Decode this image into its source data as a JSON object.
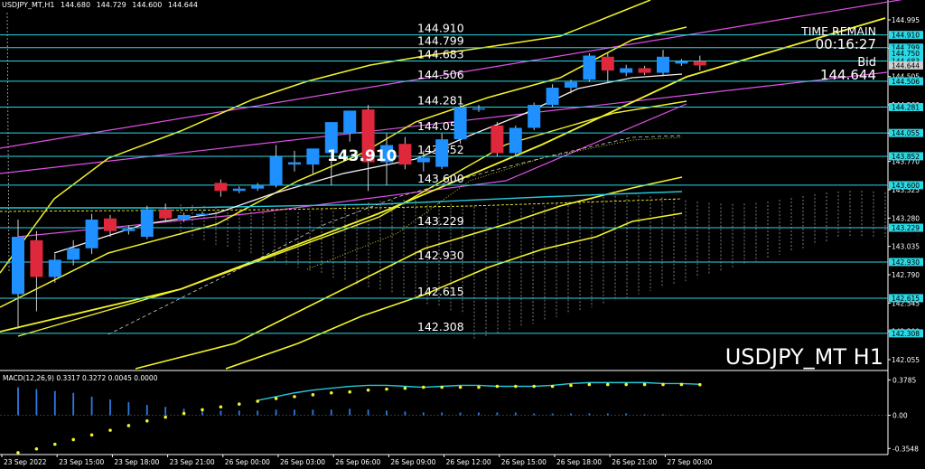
{
  "colors": {
    "background": "#000000",
    "bull_candle": "#1e90ff",
    "bear_candle": "#e0283c",
    "level_line": "#2bd8e4",
    "magenta_channel": "#e050e8",
    "yellow_band": "#f2f22a",
    "cyan_ma": "#22c8d8",
    "white_ma": "#f4f0f0",
    "cloud_dash": "#cfcfcf",
    "macd_signal": "#f2f22a",
    "macd_line": "#22c8d8",
    "macd_hist": "#2e7be0",
    "label_box": "#2bd8e4"
  },
  "header": {
    "symbol": "USDJPY_MT,H1",
    "open": "144.680",
    "high": "144.729",
    "low": "144.600",
    "close": "144.644"
  },
  "overlay": {
    "time_remain_label": "TIME REMAIN",
    "time_remain_value": "00:16:27",
    "bid_label": "Bid",
    "bid_value": "144.644",
    "big_symbol": "USDJPY_MT H1",
    "highlight_price": "143.910"
  },
  "chart_data": [
    {
      "type": "candlestick",
      "title": "USDJPY_MT H1",
      "ylim": [
        142.0,
        145.12
      ],
      "x_tick_labels": [
        "23 Sep 2022",
        "23 Sep 15:00",
        "23 Sep 18:00",
        "23 Sep 21:00",
        "26 Sep 00:00",
        "26 Sep 03:00",
        "26 Sep 06:00",
        "26 Sep 09:00",
        "26 Sep 12:00",
        "26 Sep 15:00",
        "26 Sep 18:00",
        "26 Sep 21:00",
        "27 Sep 00:00"
      ],
      "y_tick_labels": [
        "144.995",
        "144.750",
        "144.505",
        "144.260",
        "144.015",
        "143.770",
        "143.525",
        "143.280",
        "143.035",
        "142.790",
        "142.545",
        "142.300",
        "142.055"
      ],
      "candles": [
        {
          "o": 142.65,
          "h": 143.3,
          "l": 142.35,
          "c": 143.15
        },
        {
          "o": 143.12,
          "h": 143.2,
          "l": 142.5,
          "c": 142.8
        },
        {
          "o": 142.8,
          "h": 143.0,
          "l": 142.75,
          "c": 142.95
        },
        {
          "o": 142.95,
          "h": 143.12,
          "l": 142.9,
          "c": 143.05
        },
        {
          "o": 143.05,
          "h": 143.35,
          "l": 143.0,
          "c": 143.3
        },
        {
          "o": 143.31,
          "h": 143.34,
          "l": 143.15,
          "c": 143.2
        },
        {
          "o": 143.2,
          "h": 143.25,
          "l": 143.17,
          "c": 143.22
        },
        {
          "o": 143.15,
          "h": 143.42,
          "l": 143.13,
          "c": 143.39
        },
        {
          "o": 143.39,
          "h": 143.44,
          "l": 143.28,
          "c": 143.31
        },
        {
          "o": 143.3,
          "h": 143.36,
          "l": 143.28,
          "c": 143.34
        },
        {
          "o": 143.34,
          "h": 143.37,
          "l": 143.33,
          "c": 143.35
        },
        {
          "o": 143.62,
          "h": 143.65,
          "l": 143.5,
          "c": 143.55
        },
        {
          "o": 143.55,
          "h": 143.59,
          "l": 143.53,
          "c": 143.57
        },
        {
          "o": 143.57,
          "h": 143.62,
          "l": 143.55,
          "c": 143.6
        },
        {
          "o": 143.6,
          "h": 143.95,
          "l": 143.58,
          "c": 143.85
        },
        {
          "o": 143.78,
          "h": 143.9,
          "l": 143.72,
          "c": 143.8
        },
        {
          "o": 143.78,
          "h": 143.9,
          "l": 143.7,
          "c": 143.92
        },
        {
          "o": 143.88,
          "h": 144.1,
          "l": 143.6,
          "c": 144.15
        },
        {
          "o": 144.05,
          "h": 144.25,
          "l": 143.98,
          "c": 144.25
        },
        {
          "o": 144.26,
          "h": 144.3,
          "l": 143.55,
          "c": 143.8
        },
        {
          "o": 143.8,
          "h": 144.05,
          "l": 143.6,
          "c": 143.95
        },
        {
          "o": 143.96,
          "h": 144.02,
          "l": 143.74,
          "c": 143.78
        },
        {
          "o": 143.8,
          "h": 143.9,
          "l": 143.72,
          "c": 143.84
        },
        {
          "o": 143.76,
          "h": 144.05,
          "l": 143.74,
          "c": 144.0
        },
        {
          "o": 144.0,
          "h": 144.3,
          "l": 143.96,
          "c": 144.28
        },
        {
          "o": 144.26,
          "h": 144.3,
          "l": 144.24,
          "c": 144.27
        },
        {
          "o": 144.12,
          "h": 144.15,
          "l": 143.85,
          "c": 143.88
        },
        {
          "o": 143.88,
          "h": 144.12,
          "l": 143.85,
          "c": 144.1
        },
        {
          "o": 144.1,
          "h": 144.32,
          "l": 144.08,
          "c": 144.3
        },
        {
          "o": 144.3,
          "h": 144.48,
          "l": 144.28,
          "c": 144.45
        },
        {
          "o": 144.45,
          "h": 144.52,
          "l": 144.4,
          "c": 144.5
        },
        {
          "o": 144.52,
          "h": 144.75,
          "l": 144.5,
          "c": 144.73
        },
        {
          "o": 144.72,
          "h": 144.76,
          "l": 144.5,
          "c": 144.6
        },
        {
          "o": 144.58,
          "h": 144.65,
          "l": 144.55,
          "c": 144.62
        },
        {
          "o": 144.62,
          "h": 144.64,
          "l": 144.56,
          "c": 144.58
        },
        {
          "o": 144.58,
          "h": 144.78,
          "l": 144.55,
          "c": 144.72
        },
        {
          "o": 144.66,
          "h": 144.7,
          "l": 144.64,
          "c": 144.68
        },
        {
          "o": 144.68,
          "h": 144.729,
          "l": 144.6,
          "c": 144.644
        }
      ],
      "levels": [
        {
          "label": "144.910",
          "price": 144.91
        },
        {
          "label": "144.799",
          "price": 144.799
        },
        {
          "label": "144.683",
          "price": 144.683
        },
        {
          "label": "144.506",
          "price": 144.506
        },
        {
          "label": "144.281",
          "price": 144.281
        },
        {
          "label": "144.055",
          "price": 144.055
        },
        {
          "label": "143.852",
          "price": 143.852
        },
        {
          "label": "143.600",
          "price": 143.6
        },
        {
          "label": "143.229",
          "price": 143.229
        },
        {
          "label": "142.930",
          "price": 142.93
        },
        {
          "label": "142.615",
          "price": 142.615
        },
        {
          "label": "142.308",
          "price": 142.308
        }
      ],
      "right_label_boxes": [
        "144.910",
        "144.799",
        "144.750",
        "144.683",
        "144.644",
        "144.506",
        "144.281",
        "144.055",
        "143.852",
        "143.600",
        "143.229",
        "142.930",
        "142.615",
        "142.308"
      ]
    },
    {
      "type": "bar",
      "title": "MACD(12,26,9) 0.3317 0.3272 0.0045 0.0000",
      "ylim": [
        -0.42,
        0.46
      ],
      "y_tick_labels": [
        "0.3785",
        "0.00",
        "-0.3548"
      ],
      "histogram": [
        0.3,
        0.28,
        0.26,
        0.24,
        0.2,
        0.17,
        0.14,
        0.11,
        0.09,
        0.07,
        0.06,
        0.05,
        0.05,
        0.05,
        0.06,
        0.06,
        0.06,
        0.06,
        0.07,
        0.06,
        0.05,
        0.04,
        0.03,
        0.03,
        0.03,
        0.03,
        0.03,
        0.03,
        0.02,
        0.02,
        0.02,
        0.02,
        0.02,
        0.02,
        0.01,
        0.01,
        0.005,
        0.0045
      ],
      "signal": [
        -0.4,
        -0.36,
        -0.31,
        -0.26,
        -0.21,
        -0.16,
        -0.11,
        -0.06,
        -0.02,
        0.02,
        0.06,
        0.09,
        0.12,
        0.15,
        0.18,
        0.2,
        0.22,
        0.24,
        0.25,
        0.27,
        0.28,
        0.29,
        0.3,
        0.3,
        0.3,
        0.3,
        0.31,
        0.31,
        0.31,
        0.31,
        0.32,
        0.33,
        0.33,
        0.33,
        0.33,
        0.33,
        0.33,
        0.3272
      ],
      "macd": [
        null,
        null,
        null,
        null,
        null,
        null,
        null,
        null,
        null,
        null,
        null,
        null,
        null,
        0.16,
        0.2,
        0.24,
        0.27,
        0.29,
        0.31,
        0.32,
        0.32,
        0.31,
        0.3,
        0.31,
        0.32,
        0.32,
        0.31,
        0.31,
        0.31,
        0.32,
        0.34,
        0.35,
        0.35,
        0.35,
        0.35,
        0.34,
        0.34,
        0.3317
      ]
    }
  ]
}
